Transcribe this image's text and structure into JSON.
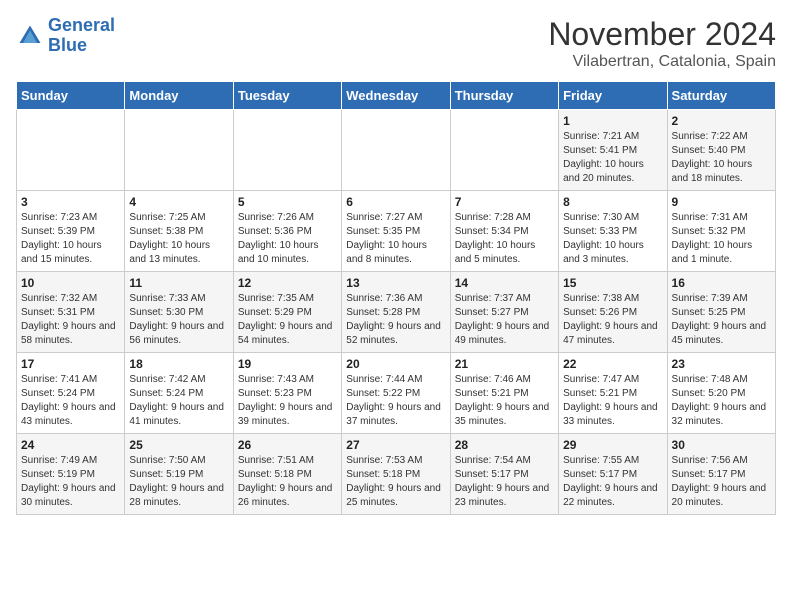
{
  "logo": {
    "line1": "General",
    "line2": "Blue"
  },
  "title": "November 2024",
  "subtitle": "Vilabertran, Catalonia, Spain",
  "headers": [
    "Sunday",
    "Monday",
    "Tuesday",
    "Wednesday",
    "Thursday",
    "Friday",
    "Saturday"
  ],
  "weeks": [
    [
      {
        "day": "",
        "info": ""
      },
      {
        "day": "",
        "info": ""
      },
      {
        "day": "",
        "info": ""
      },
      {
        "day": "",
        "info": ""
      },
      {
        "day": "",
        "info": ""
      },
      {
        "day": "1",
        "info": "Sunrise: 7:21 AM\nSunset: 5:41 PM\nDaylight: 10 hours and 20 minutes."
      },
      {
        "day": "2",
        "info": "Sunrise: 7:22 AM\nSunset: 5:40 PM\nDaylight: 10 hours and 18 minutes."
      }
    ],
    [
      {
        "day": "3",
        "info": "Sunrise: 7:23 AM\nSunset: 5:39 PM\nDaylight: 10 hours and 15 minutes."
      },
      {
        "day": "4",
        "info": "Sunrise: 7:25 AM\nSunset: 5:38 PM\nDaylight: 10 hours and 13 minutes."
      },
      {
        "day": "5",
        "info": "Sunrise: 7:26 AM\nSunset: 5:36 PM\nDaylight: 10 hours and 10 minutes."
      },
      {
        "day": "6",
        "info": "Sunrise: 7:27 AM\nSunset: 5:35 PM\nDaylight: 10 hours and 8 minutes."
      },
      {
        "day": "7",
        "info": "Sunrise: 7:28 AM\nSunset: 5:34 PM\nDaylight: 10 hours and 5 minutes."
      },
      {
        "day": "8",
        "info": "Sunrise: 7:30 AM\nSunset: 5:33 PM\nDaylight: 10 hours and 3 minutes."
      },
      {
        "day": "9",
        "info": "Sunrise: 7:31 AM\nSunset: 5:32 PM\nDaylight: 10 hours and 1 minute."
      }
    ],
    [
      {
        "day": "10",
        "info": "Sunrise: 7:32 AM\nSunset: 5:31 PM\nDaylight: 9 hours and 58 minutes."
      },
      {
        "day": "11",
        "info": "Sunrise: 7:33 AM\nSunset: 5:30 PM\nDaylight: 9 hours and 56 minutes."
      },
      {
        "day": "12",
        "info": "Sunrise: 7:35 AM\nSunset: 5:29 PM\nDaylight: 9 hours and 54 minutes."
      },
      {
        "day": "13",
        "info": "Sunrise: 7:36 AM\nSunset: 5:28 PM\nDaylight: 9 hours and 52 minutes."
      },
      {
        "day": "14",
        "info": "Sunrise: 7:37 AM\nSunset: 5:27 PM\nDaylight: 9 hours and 49 minutes."
      },
      {
        "day": "15",
        "info": "Sunrise: 7:38 AM\nSunset: 5:26 PM\nDaylight: 9 hours and 47 minutes."
      },
      {
        "day": "16",
        "info": "Sunrise: 7:39 AM\nSunset: 5:25 PM\nDaylight: 9 hours and 45 minutes."
      }
    ],
    [
      {
        "day": "17",
        "info": "Sunrise: 7:41 AM\nSunset: 5:24 PM\nDaylight: 9 hours and 43 minutes."
      },
      {
        "day": "18",
        "info": "Sunrise: 7:42 AM\nSunset: 5:24 PM\nDaylight: 9 hours and 41 minutes."
      },
      {
        "day": "19",
        "info": "Sunrise: 7:43 AM\nSunset: 5:23 PM\nDaylight: 9 hours and 39 minutes."
      },
      {
        "day": "20",
        "info": "Sunrise: 7:44 AM\nSunset: 5:22 PM\nDaylight: 9 hours and 37 minutes."
      },
      {
        "day": "21",
        "info": "Sunrise: 7:46 AM\nSunset: 5:21 PM\nDaylight: 9 hours and 35 minutes."
      },
      {
        "day": "22",
        "info": "Sunrise: 7:47 AM\nSunset: 5:21 PM\nDaylight: 9 hours and 33 minutes."
      },
      {
        "day": "23",
        "info": "Sunrise: 7:48 AM\nSunset: 5:20 PM\nDaylight: 9 hours and 32 minutes."
      }
    ],
    [
      {
        "day": "24",
        "info": "Sunrise: 7:49 AM\nSunset: 5:19 PM\nDaylight: 9 hours and 30 minutes."
      },
      {
        "day": "25",
        "info": "Sunrise: 7:50 AM\nSunset: 5:19 PM\nDaylight: 9 hours and 28 minutes."
      },
      {
        "day": "26",
        "info": "Sunrise: 7:51 AM\nSunset: 5:18 PM\nDaylight: 9 hours and 26 minutes."
      },
      {
        "day": "27",
        "info": "Sunrise: 7:53 AM\nSunset: 5:18 PM\nDaylight: 9 hours and 25 minutes."
      },
      {
        "day": "28",
        "info": "Sunrise: 7:54 AM\nSunset: 5:17 PM\nDaylight: 9 hours and 23 minutes."
      },
      {
        "day": "29",
        "info": "Sunrise: 7:55 AM\nSunset: 5:17 PM\nDaylight: 9 hours and 22 minutes."
      },
      {
        "day": "30",
        "info": "Sunrise: 7:56 AM\nSunset: 5:17 PM\nDaylight: 9 hours and 20 minutes."
      }
    ]
  ]
}
